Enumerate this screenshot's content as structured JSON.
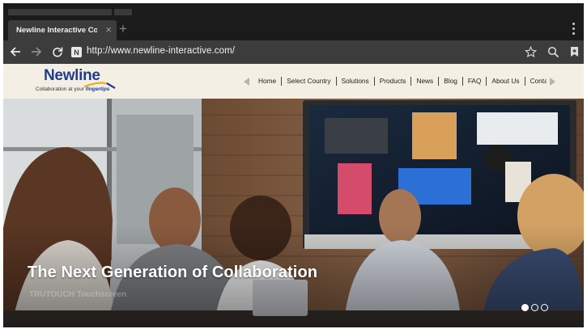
{
  "browser": {
    "tab": {
      "title": "Newline Interactive Colla...",
      "close_glyph": "×"
    },
    "new_tab_glyph": "+",
    "url": "http://www.newline-interactive.com/",
    "site_badge": "N",
    "icons": [
      "back-arrow-icon",
      "forward-arrow-icon",
      "reload-icon",
      "star-icon",
      "search-icon",
      "bookmark-icon",
      "menu-dots-icon"
    ]
  },
  "site": {
    "logo": {
      "word": "Newline",
      "tagline_plain": "Collaboration at your ",
      "tagline_emph": "fingertips"
    },
    "nav": [
      "Home",
      "Select Country",
      "Solutions",
      "Products",
      "News",
      "Blog",
      "FAQ",
      "About Us",
      "Contact Us"
    ]
  },
  "hero": {
    "headline": "The Next Generation of Collaboration",
    "subline": "TRUTOUCH Touchscreen",
    "slides": 3,
    "active_slide": 1
  },
  "colors": {
    "brand_blue": "#1f3d8a",
    "brand_orange": "#f2a30f",
    "header_bg": "#f4efe5",
    "toolbar_bg": "#3c3c3c"
  }
}
